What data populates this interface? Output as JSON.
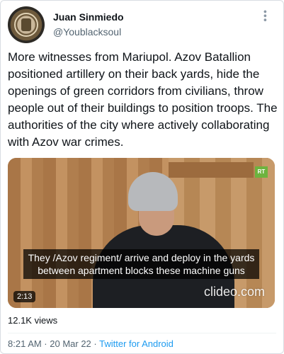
{
  "author": {
    "name": "Juan Sinmiedo",
    "handle": "@Youblacksoul",
    "avatar_icon": "emblem-avatar-icon"
  },
  "more_icon": "more-options-icon",
  "tweet": {
    "text": "More witnesses from Mariupol. Azov Batallion positioned artillery on their back yards, hide the openings of green corridors from civilians, throw people out of their buildings to position troops. The authorities of the city where actively collaborating with Azov war crimes."
  },
  "video": {
    "caption": "They /Azov regiment/ arrive and deploy in the yards between apartment blocks these machine guns",
    "duration": "2:13",
    "watermark": "clideo.com",
    "channel_logo": "RT"
  },
  "views": "12.1K views",
  "meta": {
    "time_date": "8:21 AM · 20 Mar 22 · ",
    "app": "Twitter for Android"
  },
  "colors": {
    "link": "#1d9bf0",
    "secondary_text": "#536471"
  }
}
